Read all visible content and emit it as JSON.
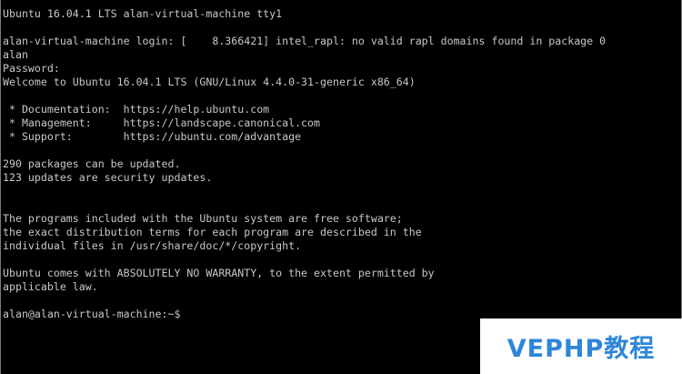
{
  "terminal": {
    "lines": [
      "Ubuntu 16.04.1 LTS alan-virtual-machine tty1",
      "",
      "alan-virtual-machine login: [    8.366421] intel_rapl: no valid rapl domains found in package 0",
      "alan",
      "Password:",
      "Welcome to Ubuntu 16.04.1 LTS (GNU/Linux 4.4.0-31-generic x86_64)",
      "",
      " * Documentation:  https://help.ubuntu.com",
      " * Management:     https://landscape.canonical.com",
      " * Support:        https://ubuntu.com/advantage",
      "",
      "290 packages can be updated.",
      "123 updates are security updates.",
      "",
      "",
      "The programs included with the Ubuntu system are free software;",
      "the exact distribution terms for each program are described in the",
      "individual files in /usr/share/doc/*/copyright.",
      "",
      "Ubuntu comes with ABSOLUTELY NO WARRANTY, to the extent permitted by",
      "applicable law.",
      "",
      "alan@alan-virtual-machine:~$"
    ]
  },
  "watermark": {
    "text": "VEPHP教程",
    "color": "#2e86d6"
  }
}
